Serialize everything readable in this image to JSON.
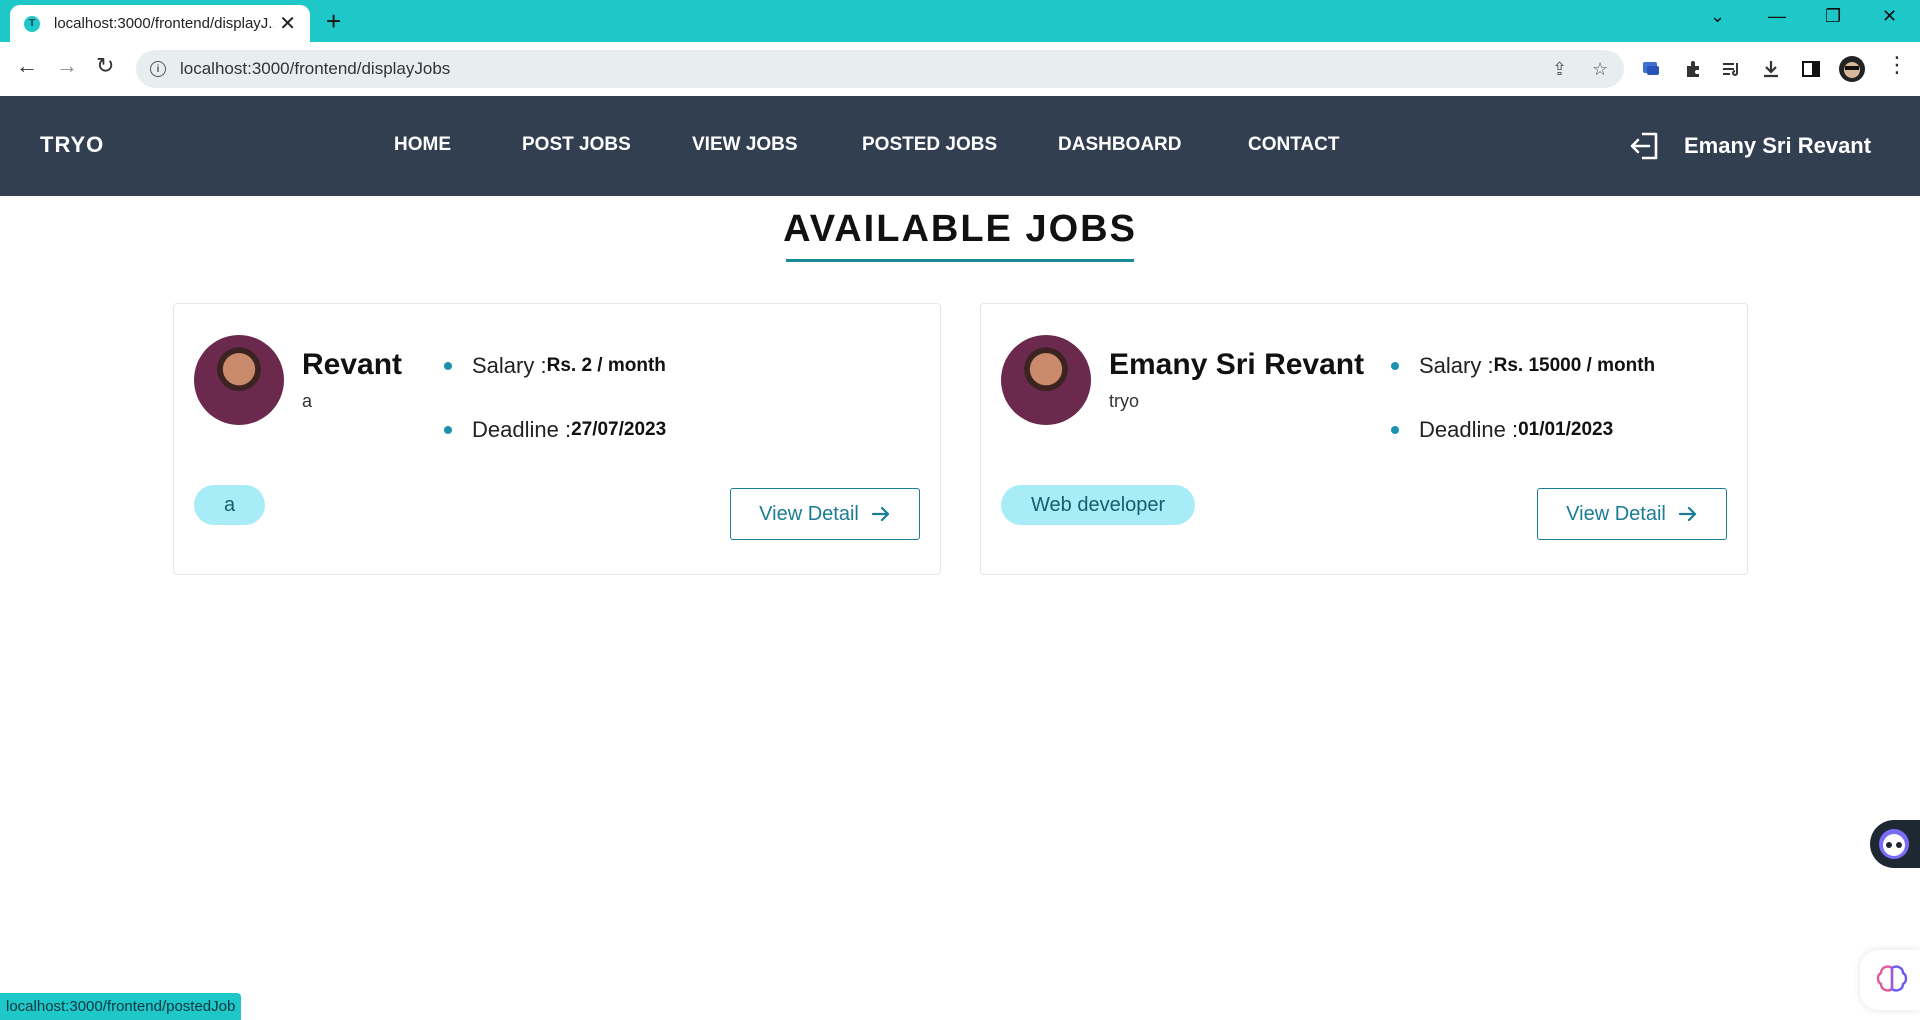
{
  "browser": {
    "tab_title": "localhost:3000/frontend/displayJ...",
    "tab_favicon_letter": "T",
    "url": "localhost:3000/frontend/displayJobs",
    "status_url": "localhost:3000/frontend/postedJob"
  },
  "navbar": {
    "brand": "TRYO",
    "links": [
      "HOME",
      "POST JOBS",
      "VIEW JOBS",
      "POSTED JOBS",
      "DASHBOARD",
      "CONTACT"
    ],
    "user_name": "Emany Sri Revant"
  },
  "page": {
    "title": "AVAILABLE JOBS"
  },
  "jobs": [
    {
      "name": "Revant",
      "company": "a",
      "salary_label": "Salary :",
      "salary_value": "Rs. 2 / month",
      "deadline_label": "Deadline :",
      "deadline_value": "27/07/2023",
      "tag": "a",
      "button_label": "View Detail"
    },
    {
      "name": "Emany Sri Revant",
      "company": "tryo",
      "salary_label": "Salary :",
      "salary_value": "Rs. 15000 / month",
      "deadline_label": "Deadline :",
      "deadline_value": "01/01/2023",
      "tag": "Web developer",
      "button_label": "View Detail"
    }
  ],
  "colors": {
    "browser_accent": "#1ec8c8",
    "navbar_bg": "#323f51",
    "primary": "#1a7d93",
    "tag_bg": "#a7ecf6"
  }
}
